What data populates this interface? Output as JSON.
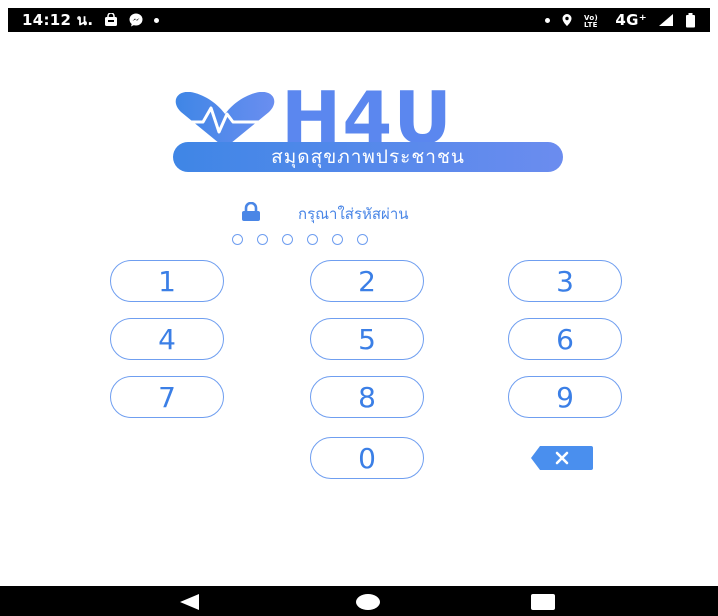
{
  "status_bar": {
    "time": "14:12 น.",
    "network": "4G⁺",
    "icons_left": [
      "shopping-bag-icon",
      "messenger-icon",
      "dot-icon"
    ],
    "icons_right": [
      "dot-icon",
      "location-icon",
      "volte-icon",
      "network-type",
      "signal-icon",
      "battery-icon"
    ]
  },
  "logo": {
    "brand": "H4U",
    "subtitle": "สมุดสุขภาพประชาชน",
    "colors": {
      "primary": "#5b87ef",
      "gradient_start": "#3f86e6",
      "gradient_end": "#6b8cef"
    }
  },
  "lock_prompt": {
    "text": "กรุณาใส่รหัสผ่าน",
    "icon": "lock-icon"
  },
  "pin": {
    "length": 6,
    "filled": 0
  },
  "keypad": {
    "keys": [
      "1",
      "2",
      "3",
      "4",
      "5",
      "6",
      "7",
      "8",
      "9",
      "0"
    ],
    "backspace_icon": "backspace-icon",
    "accent_color": "#3b7fe6",
    "border_color": "#6f9ef0"
  },
  "navigation_bar": {
    "buttons": [
      "back-icon",
      "home-icon",
      "recents-icon"
    ]
  }
}
